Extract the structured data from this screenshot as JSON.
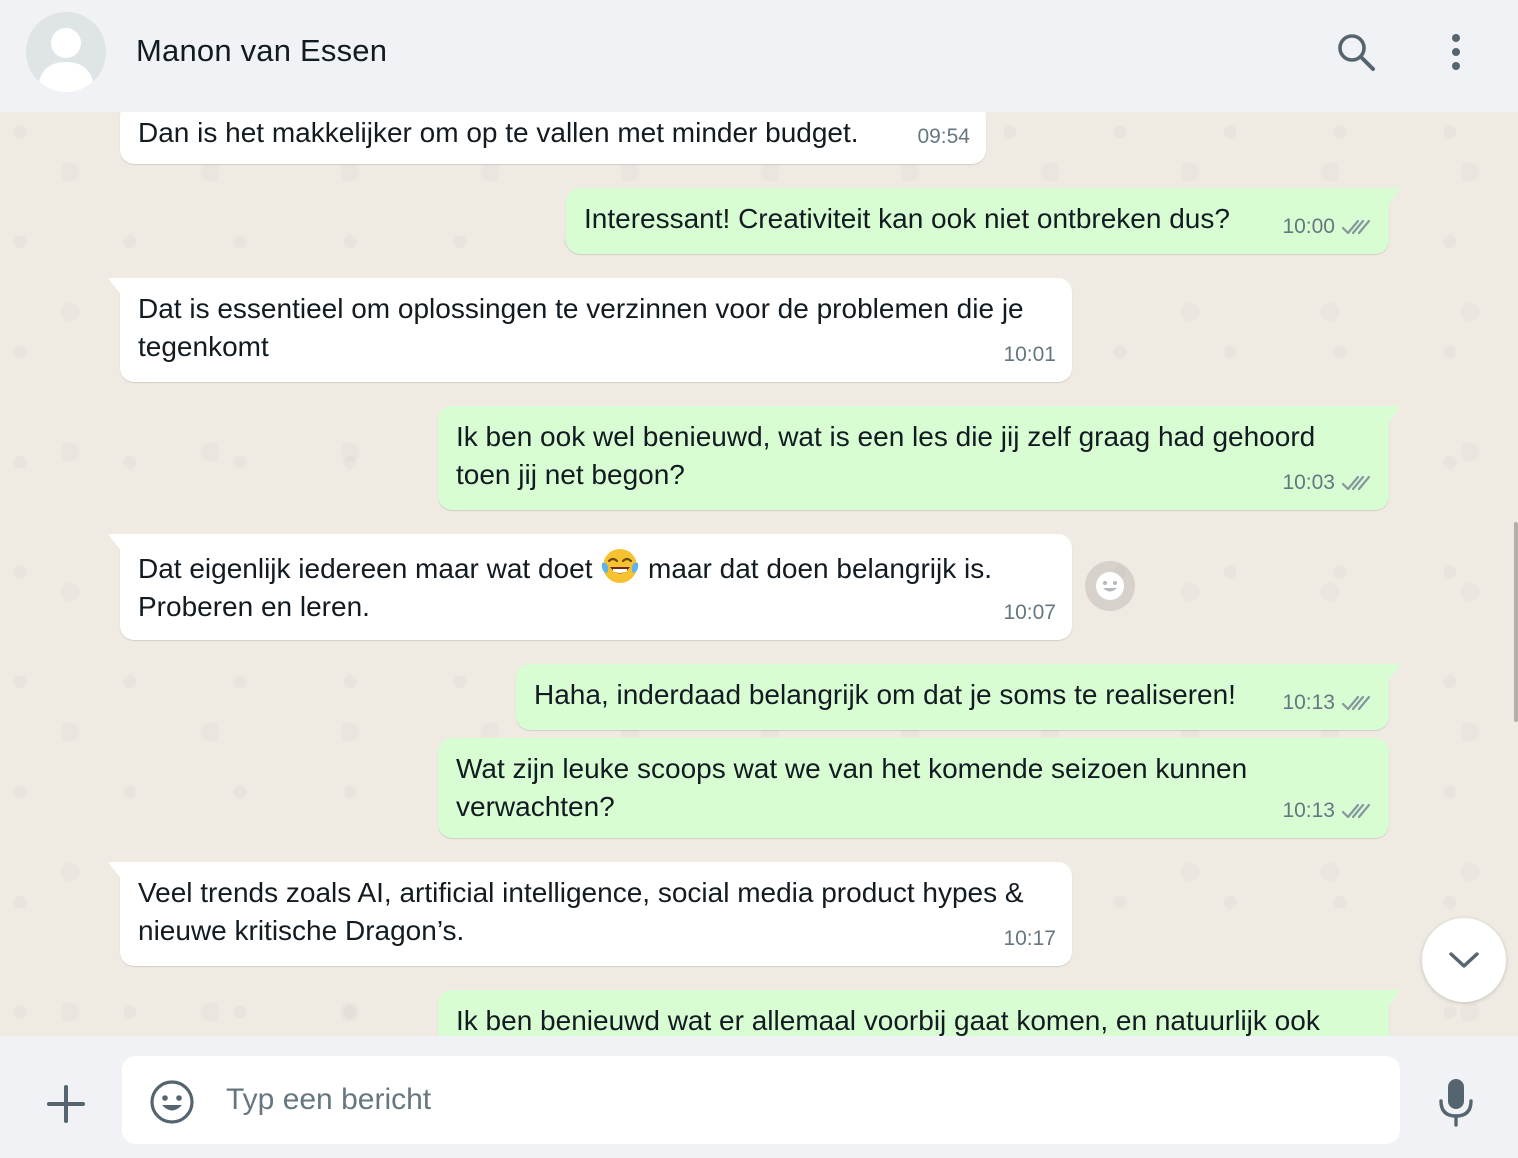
{
  "header": {
    "contact_name": "Manon van Essen",
    "icons": [
      "avatar-placeholder",
      "search-icon",
      "more-vertical-icon"
    ]
  },
  "messages": [
    {
      "direction": "in",
      "text": "Dan is het makkelijker om op te vallen met minder budget.",
      "time": "09:54"
    },
    {
      "direction": "out",
      "text": "Interessant! Creativiteit kan ook niet ontbreken dus?",
      "time": "10:00",
      "status": "read"
    },
    {
      "direction": "in",
      "text": "Dat is essentieel om oplossingen te verzinnen voor de problemen die je tegenkomt",
      "time": "10:01"
    },
    {
      "direction": "out",
      "text": "Ik ben ook wel benieuwd, wat is een les die jij zelf graag had gehoord toen jij net begon?",
      "time": "10:03",
      "status": "read"
    },
    {
      "direction": "in",
      "text_before": "Dat eigenlijk iedereen maar wat doet",
      "emoji": "😂",
      "text_after": "maar dat doen belangrijk is. Proberen en leren.",
      "time": "10:07"
    },
    {
      "direction": "out",
      "text": "Haha, inderdaad belangrijk om dat je soms te realiseren!",
      "time": "10:13",
      "status": "read"
    },
    {
      "direction": "out",
      "text": "Wat zijn leuke scoops wat we van het komende seizoen kunnen verwachten?",
      "time": "10:13",
      "status": "read"
    },
    {
      "direction": "in",
      "text": "Veel trends zoals AI, artificial intelligence, social media product hypes & nieuwe kritische Dragon’s.",
      "time": "10:17"
    },
    {
      "direction": "out",
      "text": "Ik ben benieuwd wat er allemaal voorbij gaat komen, en natuurlijk ook",
      "time": "",
      "status": "read"
    }
  ],
  "composer": {
    "placeholder": "Typ een bericht",
    "value": "",
    "icons": [
      "plus-icon",
      "emoji-icon",
      "microphone-icon"
    ]
  },
  "colors": {
    "chat_background": "#efeae2",
    "incoming_bubble": "#ffffff",
    "outgoing_bubble": "#d9fdd3",
    "header_footer": "#f0f2f5",
    "meta_text": "#667781"
  }
}
